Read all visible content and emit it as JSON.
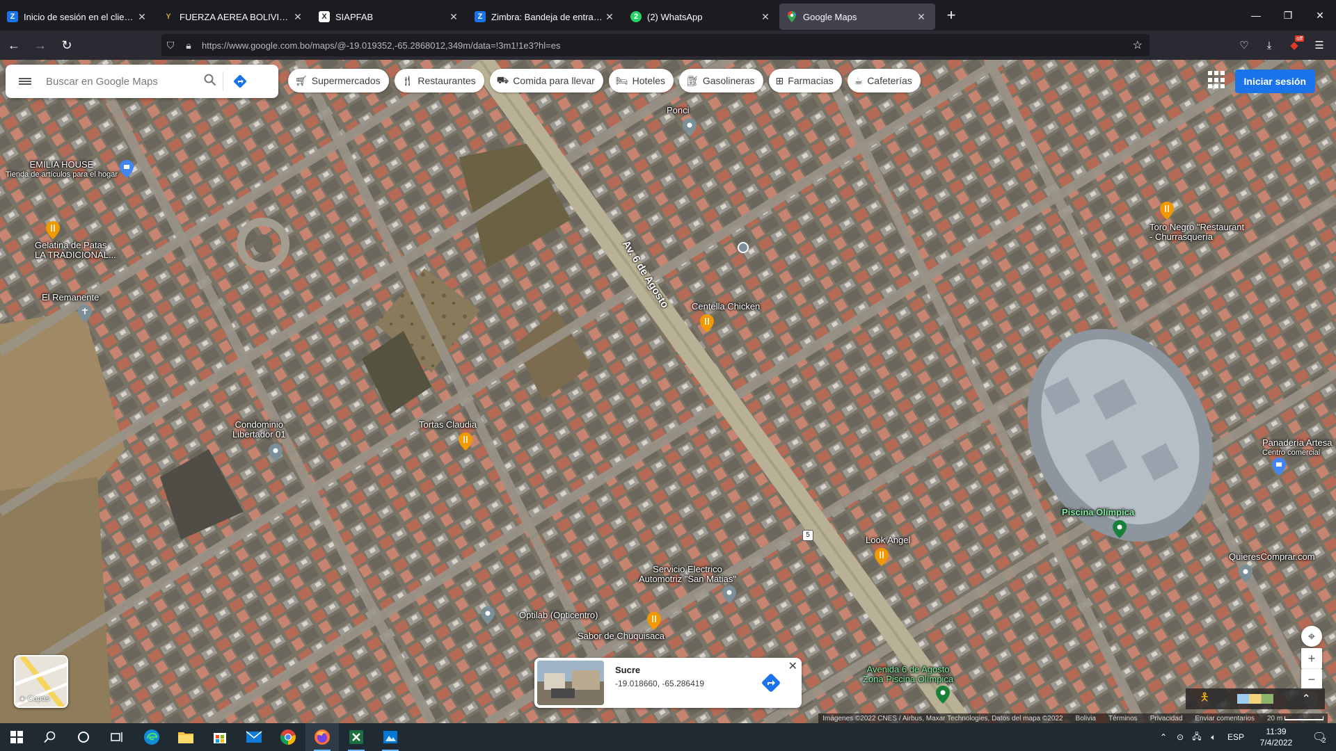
{
  "browser": {
    "tabs": [
      {
        "label": "Inicio de sesión en el cliente web",
        "icon": "zimbra-icon",
        "color": "#1a73e8",
        "glyph": "Z"
      },
      {
        "label": "FUERZA AEREA BOLIVIANA",
        "icon": "fab-logo-icon",
        "color": "#c9a227",
        "glyph": "Y"
      },
      {
        "label": "SIAPFAB",
        "icon": "siapfab-icon",
        "color": "#333333",
        "glyph": "X"
      },
      {
        "label": "Zimbra: Bandeja de entrada",
        "icon": "zimbra-icon",
        "color": "#1a73e8",
        "glyph": "Z"
      },
      {
        "label": "(2) WhatsApp",
        "icon": "whatsapp-icon",
        "color": "#25d366",
        "glyph": "2"
      },
      {
        "label": "Google Maps",
        "icon": "google-maps-icon",
        "color": "#34a853",
        "glyph": "●"
      }
    ],
    "active_tab_index": 5,
    "url": "https://www.google.com.bo/maps/@-19.019352,-65.2868012,349m/data=!3m1!1e3?hl=es"
  },
  "maps": {
    "search_placeholder": "Buscar en Google Maps",
    "chips": [
      {
        "label": "Supermercados",
        "icon": "cart-icon"
      },
      {
        "label": "Restaurantes",
        "icon": "fork-knife-icon"
      },
      {
        "label": "Comida para llevar",
        "icon": "takeout-icon"
      },
      {
        "label": "Hoteles",
        "icon": "bed-icon"
      },
      {
        "label": "Gasolineras",
        "icon": "gas-station-icon"
      },
      {
        "label": "Farmacias",
        "icon": "pharmacy-icon"
      },
      {
        "label": "Cafeterías",
        "icon": "coffee-icon"
      }
    ],
    "signin_label": "Iniciar sesión",
    "places": [
      {
        "name": "Ponci",
        "sub": "",
        "pin": "gray"
      },
      {
        "name": "EMILIA HOUSE",
        "sub": "Tienda de artículos para el hogar",
        "pin": "blue"
      },
      {
        "name": "Gelatina de Patas",
        "sub": "LA TRADICIONAL...",
        "pin": "orange"
      },
      {
        "name": "El Remanente",
        "sub": "",
        "pin": "gray"
      },
      {
        "name": "Centella Chicken",
        "sub": "",
        "pin": "orange"
      },
      {
        "name": "Toro Negro \"Restaurant",
        "sub": "- Churrasquería",
        "pin": "orange"
      },
      {
        "name": "Condominio",
        "sub": "Libertador 01",
        "pin": "gray"
      },
      {
        "name": "Tortas Claudia",
        "sub": "",
        "pin": "orange"
      },
      {
        "name": "Panadería Artesa",
        "sub": "Centro comercial",
        "pin": "blue"
      },
      {
        "name": "Piscina Olímpica",
        "sub": "",
        "pin": "green"
      },
      {
        "name": "Look Angel",
        "sub": "",
        "pin": "orange"
      },
      {
        "name": "QuieresComprar.com",
        "sub": "",
        "pin": "gray"
      },
      {
        "name": "Servicio Electrico",
        "sub": "Automotriz \"San Matias\"",
        "pin": "gray"
      },
      {
        "name": "Optilab (Opticentro)",
        "sub": "",
        "pin": "gray"
      },
      {
        "name": "Sabor de Chuquisaca",
        "sub": "",
        "pin": "orange"
      },
      {
        "name": "Avenida 6 de Agosto",
        "sub": "Zona Piscina Olímpica",
        "pin": "green"
      }
    ],
    "road_label": "Av. 6 de Agosto",
    "route_shield": "5",
    "layers_label": "Capas",
    "info_card": {
      "title": "Sucre",
      "coords": "-19.018660, -65.286419"
    },
    "attribution": {
      "imagery": "Imágenes ©2022 CNES / Airbus, Maxar Technologies, Datos del mapa ©2022",
      "country": "Bolivia",
      "terms": "Términos",
      "privacy": "Privacidad",
      "feedback": "Enviar comentarios",
      "scale": "20 m"
    },
    "colors": {
      "blue_accent": "#1a73e8",
      "orange_pin": "#f29900",
      "green_pin": "#188038"
    }
  },
  "taskbar": {
    "apps": [
      {
        "name": "windows-start-icon"
      },
      {
        "name": "search-icon"
      },
      {
        "name": "cortana-icon"
      },
      {
        "name": "task-view-icon"
      },
      {
        "name": "edge-icon"
      },
      {
        "name": "file-explorer-icon"
      },
      {
        "name": "store-icon"
      },
      {
        "name": "mail-icon"
      },
      {
        "name": "chrome-icon"
      },
      {
        "name": "firefox-icon"
      },
      {
        "name": "excel-icon"
      },
      {
        "name": "app-icon"
      }
    ],
    "language": "ESP",
    "time": "11:39",
    "date": "7/4/2022",
    "notifications": "2"
  }
}
